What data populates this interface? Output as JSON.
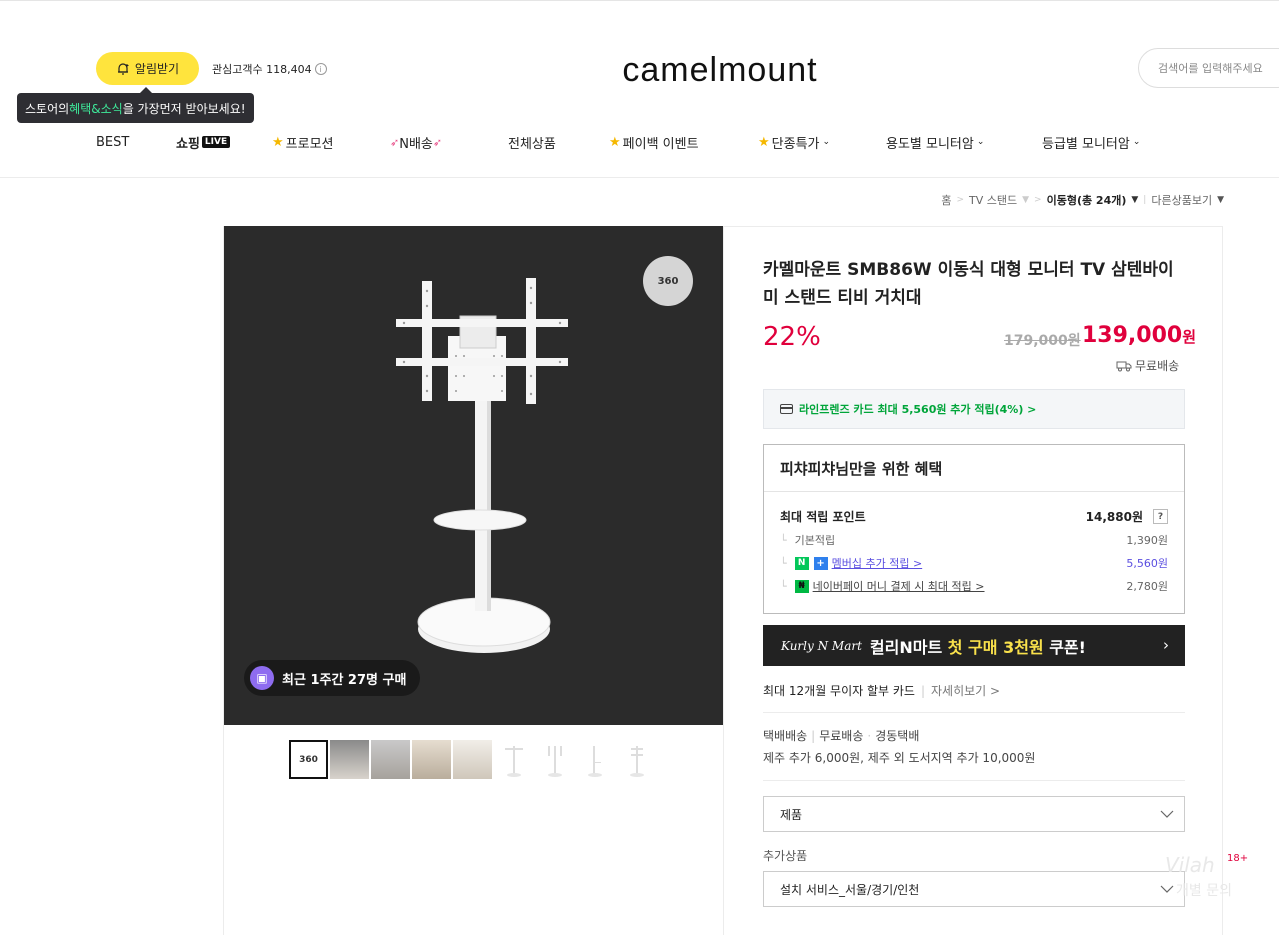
{
  "header": {
    "alarm_label": "알림받기",
    "interest_label": "관심고객수 118,404",
    "tooltip_pre": "스토어의 ",
    "tooltip_highlight": "혜택&소식",
    "tooltip_post": "을 가장먼저 받아보세요!",
    "logo_text": "camelmount",
    "search_placeholder": "검색어를 입력해주세요"
  },
  "nav": {
    "best": "BEST",
    "shopping": "쇼핑",
    "live": "LIVE",
    "promotion": "프로모션",
    "n_delivery": "N배송",
    "all_products": "전체상품",
    "payback_event": "페이백 이벤트",
    "special_deal": "단종특가",
    "by_use": "용도별 모니터암",
    "by_grade": "등급별 모니터암"
  },
  "breadcrumb": {
    "home": "홈",
    "category": "TV 스탠드",
    "current": "이동형(총 24개)",
    "other": "다른상품보기"
  },
  "gallery": {
    "badge_360": "360",
    "recent_purchase": "최근 1주간 27명 구매",
    "thumb_360": "360"
  },
  "product": {
    "title": "카멜마운트 SMB86W 이동식 대형 모니터 TV 삼텐바이미 스탠드 티비 거치대",
    "discount": "22%",
    "original_price": "179,000원",
    "sale_price_num": "139,000",
    "sale_price_unit": "원",
    "shipping": "무료배송",
    "card_benefit": "라인프렌즈 카드 최대 5,560원 추가 적립(4%) >"
  },
  "benefit": {
    "title": "피챠피챠님만을 위한 혜택",
    "max_point_label": "최대 적립 포인트",
    "max_point_value": "14,880원",
    "qmark": "?",
    "basic_label": "기본적립",
    "basic_value": "1,390원",
    "membership_label": "멤버십 추가 적립 >",
    "membership_value": "5,560원",
    "npay_label": "네이버페이 머니 결제 시 최대 적립 >",
    "npay_value": "2,780원"
  },
  "kurly": {
    "logo": "Kurly N Mart",
    "text_pre": "컬리N마트 ",
    "text_hl": "첫 구매 3천원",
    "text_post": " 쿠폰!",
    "arrow": "›"
  },
  "installment": {
    "label": "최대 12개월 무이자 할부 카드",
    "more": "자세히보기 >"
  },
  "delivery": {
    "line1_a": "택배배송",
    "line1_b": "무료배송",
    "line1_c": "경동택배",
    "line2": "제주 추가 6,000원, 제주 외 도서지역 추가 10,000원"
  },
  "options": {
    "product_select": "제품",
    "addon_label": "추가상품",
    "addon_select": "설치 서비스_서울/경기/인천"
  },
  "misc": {
    "age": "18+",
    "watermark1": "Vilah",
    "watermark2": "개별 문의"
  }
}
